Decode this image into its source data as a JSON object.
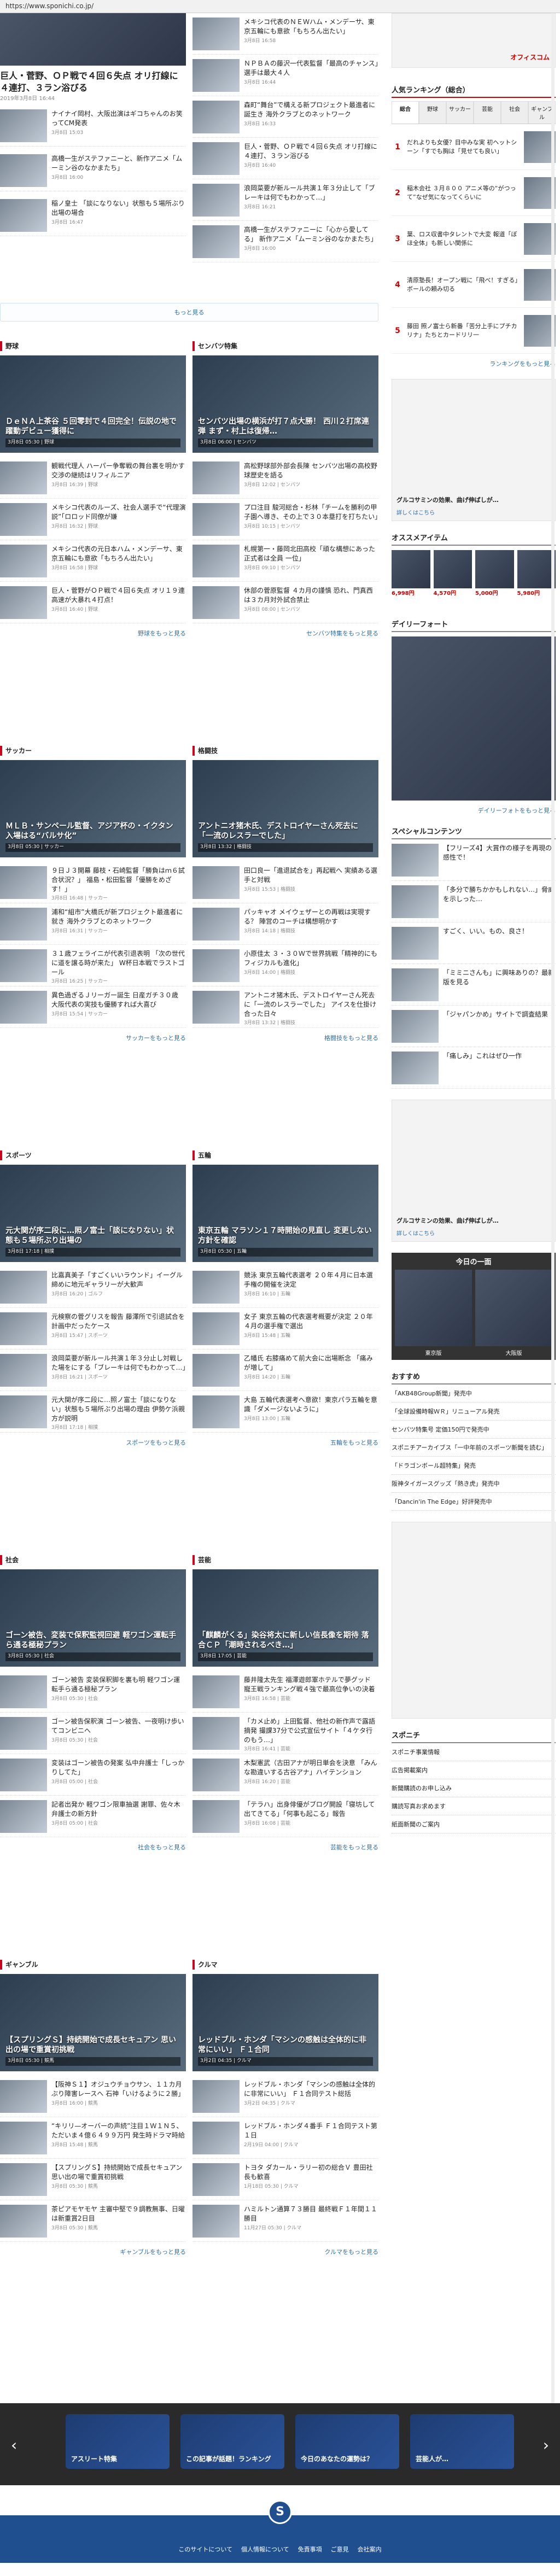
{
  "browser": {
    "url": "https://www.sponichi.co.jp/"
  },
  "top": {
    "left": {
      "headline": "巨人・菅野、ＯＰ戦で４回６失点 オリ打線に４連打、３ラン浴びる",
      "date": "2019年3月8日 16:44",
      "items": [
        {
          "title": "ナイナイ岡村、大阪出演はギコちゃんのお笑ってCM発表",
          "date": "3月8日 15:03"
        },
        {
          "title": "高橋一生がステファニーと、新作アニメ「ムーミン谷のなかまたち」",
          "date": "3月8日 16:00"
        },
        {
          "title": "稲ノ皇士 「談になりない」状態も５場所ぶり出場の場合",
          "date": "3月8日 16:47"
        }
      ]
    },
    "right": {
      "items": [
        {
          "title": "メキシコ代表のＮＥＷハム・メンデーサ、東京五輪にも意欲「もちろん出たい」",
          "date": "3月8日 16:58"
        },
        {
          "title": "ＮＰＢＡの藤沢一代表監督「最高のチャンス」選手は最大４人",
          "date": "3月8日 16:44"
        },
        {
          "title": "森町“舞台”で構える新プロジェクト最進者に誕生き 海外クラブとのネットワーク",
          "date": "3月8日 16:33"
        },
        {
          "title": "巨人・菅野、ＯＰ戦で４回６失点 オリ打線に４連打、３ラン浴びる",
          "date": "3月8日 16:40"
        },
        {
          "title": "浪岡菜要が新ルール共演１年３分止して「ブレーキは何でもわかって…」",
          "date": "3月8日 16:21"
        },
        {
          "title": "高橋一生がステファニーに「心から愛してる」 新作アニメ「ムーミン谷のなかまたち」",
          "date": "3月8日 16:00"
        }
      ]
    },
    "more": "もっと見る"
  },
  "sections": [
    {
      "title": "野球",
      "hero": {
        "caption": "ＤｅＮＡ上茶谷 ５回零封で４回完全！伝説の地で躍動デビュー獲得に",
        "meta": "3月8日 05:30 | 野球"
      },
      "items": [
        {
          "title": "観戦代理人 ハーパー争奪戦の舞台裏を明かす 交渉の継続はリフィルニア",
          "date": "3月8日 16:39 | 野球"
        },
        {
          "title": "メキシコ代表のルーズ、社会人選手で“代理演説”「ロロッド同僚が嫌",
          "date": "3月8日 16:32 | 野球"
        },
        {
          "title": "メキシコ代表の元日本ハム・メンデーサ、東京五輪にも意欲「もちろん出たい」",
          "date": "3月8日 16:58 | 野球"
        },
        {
          "title": "巨人・菅野がＯＰ戦で４回６失点 オリ１９連高速が大暴れ４打点！",
          "date": "3月8日 16:40 | 野球"
        }
      ],
      "more": "野球をもっと見る"
    },
    {
      "title": "センバツ特集",
      "hero": {
        "caption": "センバツ出場の横浜が打７点大勝！ 西川２打席連弾 まず・村上は復帰…",
        "meta": "3月8日 06:00 | センバツ"
      },
      "items": [
        {
          "title": "高松野球部外部会長陳 センバツ出場の高校野球歴史を語る",
          "date": "3月8日 12:02 | センバツ"
        },
        {
          "title": "プロ注目 駿河総合・杉林「チームを勝利の甲子園へ導き、その上で３０本塁打を打ちたい」",
          "date": "3月8日 10:15 | センバツ"
        },
        {
          "title": "札幌第一・藤岡北田高校「頑な構想にあった正式者は全員 一位」",
          "date": "3月8日 09:10 | センバツ"
        },
        {
          "title": "休部の菅原監督 ４カ月の謹慎 恐れ、門真西は３カ月対外試合禁止",
          "date": "3月8日 08:00 | センバツ"
        }
      ],
      "more": "センバツ特集をもっと見る"
    },
    {
      "title": "サッカー",
      "hero": {
        "caption": "ＭＬＢ・サンペール監督、アジア杯の・イクタン入場はる“バルサ化”",
        "meta": "3月8日 05:30 | サッカー"
      },
      "items": [
        {
          "title": "９日Ｊ３開幕 藤枝・石崎監督「勝負はｍ６試合状況？」 福島・松田監督「優勝をめざす！」",
          "date": "3月8日 16:48 | サッカー"
        },
        {
          "title": "浦和“組市”大橋氏が新プロジェクト最進者に就き 海外クラブとのネットワーク",
          "date": "3月8日 16:31 | サッカー"
        },
        {
          "title": "３１歳フェライニが代表引退表明 「次の世代に道を譲る時が来た」 W杯日本戦でラストゴール",
          "date": "3月8日 16:25 | サッカー"
        },
        {
          "title": "異色過ぎるＪリーガー誕生 日産ガチ３０歳 大阪代表の実技も優勝すれば大喜び",
          "date": "3月8日 15:54 | サッカー"
        }
      ],
      "more": "サッカーをもっと見る"
    },
    {
      "title": "格闘技",
      "hero": {
        "caption": "アントニオ猪木氏、デストロイヤーさん死去に「一流のレスラーでした」",
        "meta": "3月8日 13:32 | 格闘技"
      },
      "items": [
        {
          "title": "田口良一「進退試合を」再起戦へ 実績ある選手と対戦",
          "date": "3月8日 15:53 | 格闘技"
        },
        {
          "title": "パッキャオ メイウェザーとの再戦は実現する？ 陣営のコーチは構想明かす",
          "date": "3月8日 14:18 | 格闘技"
        },
        {
          "title": "小原佳太 ３・３０Ｗで世界挑戦「精神的にもフィジカルも進化」",
          "date": "3月8日 14:00 | 格闘技"
        },
        {
          "title": "アントニオ猪木氏、デストロイヤーさん死去に「一流のレスラーでした」 アイスを仕掛け合った日々",
          "date": "3月8日 13:32 | 格闘技"
        }
      ],
      "more": "格闘技をもっと見る"
    },
    {
      "title": "スポーツ",
      "hero": {
        "caption": "元大関が序二段に…照ノ富士「談になりない」状態も５場所ぶり出場の",
        "meta": "3月8日 17:18 | 相撲"
      },
      "items": [
        {
          "title": "比嘉真美子「すごくいいラウンド」イーグル締めに地元ギャラリーが大歓声",
          "date": "3月8日 16:20 | ゴルフ"
        },
        {
          "title": "元検察の菅グリスを報告 藤澤所で引退試合を計画中だったケース",
          "date": "3月8日 15:47 | スポーツ"
        },
        {
          "title": "浪岡菜要が新ルール共演１年３分止し対戦した場をにする「ブレーキは何でもわかって…」",
          "date": "3月8日 16:21 | スポーツ"
        },
        {
          "title": "元大関が序二段に…照ノ富士「談になりない」状態も５場所ぶり出場の理由 伊勢ケ浜親方が説明",
          "date": "3月8日 17:18 | 相撲"
        }
      ],
      "more": "スポーツをもっと見る"
    },
    {
      "title": "五輪",
      "hero": {
        "caption": "東京五輪 マラソン１７時開始の見直し 変更しない方針を確認",
        "meta": "3月8日 05:30 | 五輪"
      },
      "items": [
        {
          "title": "競泳 東京五輪代表選考 ２０年４月に日本選手権の開催を決定",
          "date": "3月8日 16:10 | 五輪"
        },
        {
          "title": "女子 東京五輪の代表選考概要が決定 ２０年４月の選手権で選出",
          "date": "3月8日 15:48 | 五輪"
        },
        {
          "title": "乙幡氏 右膝痛めて前大会に出場断念 「痛みが増して」",
          "date": "3月8日 14:20 | 五輪"
        },
        {
          "title": "大島 五輪代表選考へ意欲！東京パラ五輪を意識「ダメージないように」",
          "date": "3月8日 13:00 | 五輪"
        }
      ],
      "more": "五輪をもっと見る"
    },
    {
      "title": "社会",
      "hero": {
        "caption": "ゴーン被告、変装で保釈監視回避 軽ワゴン運転手ら通る極秘プラン",
        "meta": "3月8日 05:30 | 社会"
      },
      "items": [
        {
          "title": "ゴーン被告 変装保釈脚を裏も明 軽ワゴン運転手ら通る極秘プラン",
          "date": "3月8日 05:30 | 社会"
        },
        {
          "title": "ゴーン被告保釈演 ゴーン被告、一夜明け歩いてコンビニへ",
          "date": "3月8日 05:30 | 社会"
        },
        {
          "title": "変装はゴーン被告の発案 弘中弁護士「しっかりしてた」",
          "date": "3月8日 05:00 | 社会"
        },
        {
          "title": "記者出発か 軽ワゴン限車抽選 謝罪、佐々木弁護士の新方針",
          "date": "3月8日 05:00 | 社会"
        }
      ],
      "more": "社会をもっと見る"
    },
    {
      "title": "芸能",
      "hero": {
        "caption": "「麒麟がくる」染谷将太に新しい信長像を期待 落合ＣＰ「潮時されるべき…」",
        "meta": "3月8日 17:05 | 芸能"
      },
      "items": [
        {
          "title": "藤井隆太先生 福澤遊郎軍ホテルで夢グッド 寵王戦ランキング戦４強で最高位争いの決着",
          "date": "3月8日 16:58 | 芸能"
        },
        {
          "title": "「カメ止め」上田監督、他社の新作声で露語摘発 撮課37分で公式宣伝サイト「４ケタ行のもう…」",
          "date": "3月8日 16:41 | 芸能"
        },
        {
          "title": "木梨憲武（古田アナが明日単会を決意 「みんな勘違いする古谷アナ」ハイテンション",
          "date": "3月8日 16:20 | 芸能"
        },
        {
          "title": "「テラハ」出身俳優がブログ開設「寝坊して出てきてる」「何事も起こる」報告",
          "date": "3月8日 16:08 | 芸能"
        }
      ],
      "more": "芸能をもっと見る"
    },
    {
      "title": "ギャンブル",
      "hero": {
        "caption": "【スプリングＳ】持続開始で成長セキュアン 思い出の場で重賞初挑戦",
        "meta": "3月8日 05:30 | 競馬"
      },
      "items": [
        {
          "title": "【阪神Ｓ１】オジュウチョウサン、１１カ月ぶり障害レースへ 石神「いけるように２勝」",
          "date": "3月8日 16:00 | 競馬"
        },
        {
          "title": "“キリリ—オーバーの声続”注目１Ｗ１Ｎ５、ただいま４億６４９９万円 発生時ドラマ時給",
          "date": "3月8日 15:48 | 競馬"
        },
        {
          "title": "【スプリングＳ】持続開始で成長セキュアン 思い出の場で重賞初挑戦",
          "date": "3月8日 05:30 | 競馬"
        },
        {
          "title": "茶ピアモヤモヤ 主審中堅で９調教無事、日曜は新重賞2日目",
          "date": "3月8日 05:30 | 競馬"
        }
      ],
      "more": "ギャンブルをもっと見る"
    },
    {
      "title": "クルマ",
      "hero": {
        "caption": "レッドブル・ホンダ「マシンの感触は全体的に非常にいい」 Ｆ１合同",
        "meta": "3月2日 04:35 | クルマ"
      },
      "items": [
        {
          "title": "レッドブル・ホンダ「マシンの感触は全体的に非常にいい」 Ｆ１合同テスト総括",
          "date": "3月2日 04:35 | クルマ"
        },
        {
          "title": "レッドブル・ホンダ４番手 Ｆ１合同テスト第１日",
          "date": "2月19日 04:00 | クルマ"
        },
        {
          "title": "トヨタ ダカール・ラリー初の総合Ｖ 豊田社長も歓喜",
          "date": "1月18日 05:30 | クルマ"
        },
        {
          "title": "ハミルトン通算７３勝目 最終戦Ｆ１年間１１勝目",
          "date": "11月27日 05:30 | クルマ"
        }
      ],
      "more": "クルマをもっと見る"
    }
  ],
  "sidebar": {
    "ad_top": "オフィスコム",
    "ranking": {
      "title": "人気ランキング（総合）",
      "tabs": [
        "総合",
        "野球",
        "サッカー",
        "芸能",
        "社会",
        "ギャンブル"
      ],
      "items": [
        {
          "rank": "1",
          "text": "だれよりも女優？目中みな実 初ヘットシーン「すでも胸は「見せても良い」"
        },
        {
          "rank": "2",
          "text": "稲木会社 ３月８００ アニメ等の“がつって”なぜ気になってくらいに"
        },
        {
          "rank": "3",
          "text": "葉、ロス収書中タレントで大変 報道「ぼほ全体」も新しい関係に"
        },
        {
          "rank": "4",
          "text": "清原塾長！オープン戦に「飛べ！すぎる」ボールの頼み切る"
        },
        {
          "rank": "5",
          "text": "藤田 照ノ富士ら新番「苦分上手にプチカリナ」たちとカードリリ一"
        }
      ],
      "more": "ランキングをもっと見る"
    },
    "ad_gluco": {
      "title": "グルコサミンの効果、曲げ伸ばしが…",
      "btn": "詳しくはこちら"
    },
    "recommend": {
      "title": "オススメアイテム",
      "prices": [
        "6,998円",
        "4,570円",
        "5,000円",
        "5,980円"
      ]
    },
    "daily": {
      "title": "デイリーフォート",
      "more": "デイリーフォトをもっと見る"
    },
    "special": {
      "title": "スペシャルコンテンツ",
      "items": [
        "【フリーズ4】大賞作の様子を再現の感性で！",
        "「多分で勝ちかかもしれない…」脅威を示しった…",
        "すごく、いい。もの、良さ！",
        "「ミミニさんも」に興味ありの？最新版を見る",
        "「ジャパンかめ」サイトで調査結果",
        "「痛しみ」これはぜひ一作"
      ]
    },
    "ad_gluco2": {
      "title": "グルコサミンの効果、曲げ伸ばしが…",
      "btn": "詳しくはこちら"
    },
    "todays": {
      "title": "今日の一面",
      "labels": [
        "東京版",
        "大阪版"
      ]
    },
    "osusume": {
      "title": "おすすめ",
      "items": [
        "「AKB48Group新聞」発売中",
        "「全球設備時報ＷＲ」リニューアル発売",
        "センバツ特集号 定価150円で発売中",
        "スポニチアーカイブス「一中年前のスポーツ新聞を読む」",
        "「ドラゴンボール超特集」発売",
        "阪神タイガースグッズ「熱き虎」発売中",
        "「Dancin'in The Edge」好評発売中"
      ]
    },
    "sponichi": {
      "title": "スポニチ",
      "items": [
        "スポニチ事業情報",
        "広告掲載案内",
        "新聞購読のお申し込み",
        "購読写真お求めます",
        "紙面新聞のご案内"
      ]
    }
  },
  "carousel": {
    "items": [
      "アスリート特集",
      "この記事が話題！ランキング",
      "今日のあなたの運勢は？",
      "芸能人が…"
    ]
  },
  "footer": {
    "logo": "S",
    "links": [
      "このサイトについて",
      "個人情報について",
      "免責事項",
      "ご意見",
      "会社案内"
    ]
  }
}
